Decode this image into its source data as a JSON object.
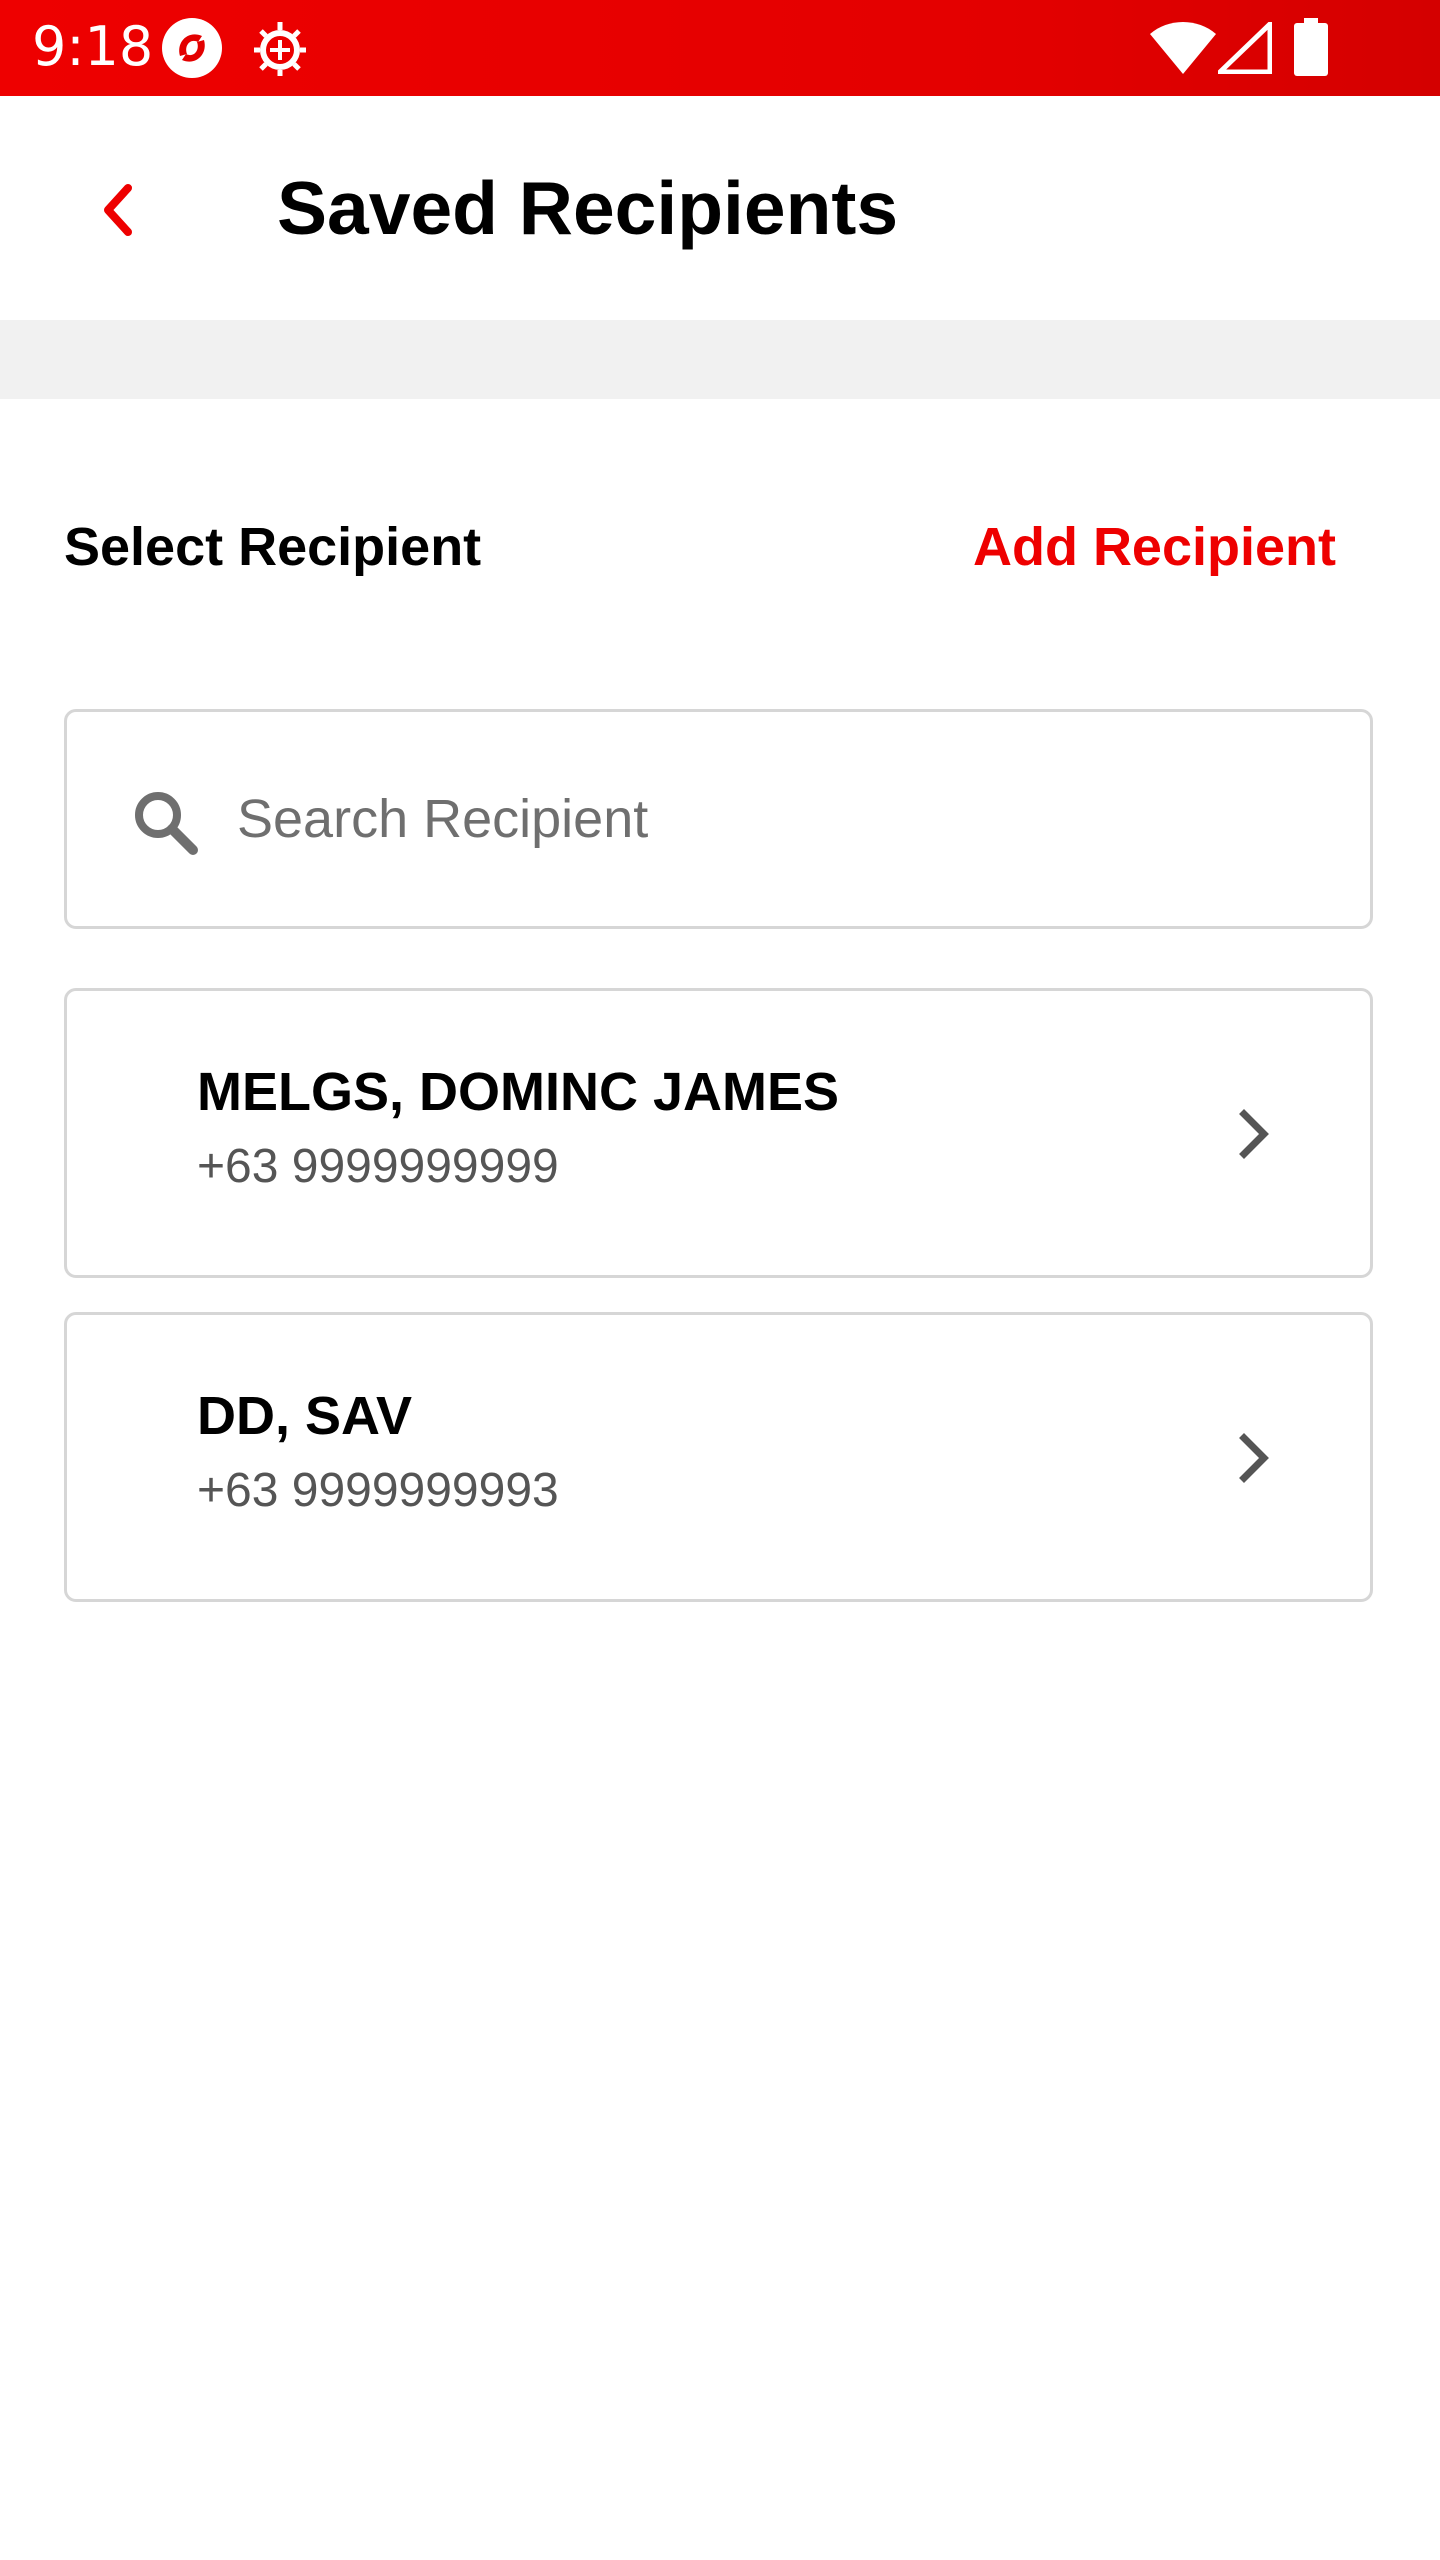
{
  "status_bar": {
    "time": "9:18",
    "icons": [
      "app-notification-icon",
      "bug-icon",
      "wifi-icon",
      "signal-icon",
      "battery-icon"
    ]
  },
  "app_bar": {
    "back_icon": "chevron-left-icon",
    "title": "Saved Recipients"
  },
  "section": {
    "label": "Select Recipient",
    "add_label": "Add Recipient"
  },
  "search": {
    "placeholder": "Search Recipient",
    "value": ""
  },
  "recipients": [
    {
      "name": "MELGS, DOMINC JAMES",
      "phone": "+63 9999999999"
    },
    {
      "name": "DD, SAV",
      "phone": "+63 9999999993"
    }
  ],
  "colors": {
    "brand_red": "#ee0000",
    "border": "#d6d6d6",
    "band": "#f1f1f1",
    "icon_gray": "#555555"
  }
}
